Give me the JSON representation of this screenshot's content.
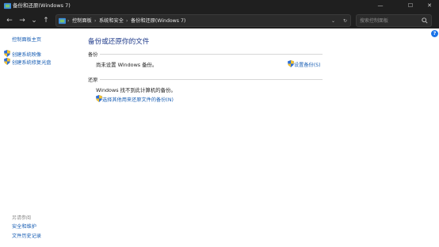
{
  "window": {
    "title": "备份和还原(Windows 7)",
    "minimize": "—",
    "maximize": "☐",
    "close": "✕"
  },
  "nav": {
    "back": "←",
    "forward": "→",
    "recent": "⌄",
    "up": "↑",
    "breadcrumbs": [
      "控制面板",
      "系统和安全",
      "备份和还原(Windows 7)"
    ],
    "separator": "›",
    "dropdown": "⌄",
    "refresh": "↻"
  },
  "search": {
    "placeholder": "搜索控制面板",
    "icon": "search-icon"
  },
  "sidebar": {
    "home": "控制面板主页",
    "tasks": [
      {
        "label": "创建系统映像",
        "icon": "shield-icon"
      },
      {
        "label": "创建系统修复光盘",
        "icon": "shield-icon"
      }
    ],
    "see_also": "另请参阅",
    "links": [
      "安全和维护",
      "文件历史记录"
    ]
  },
  "main": {
    "title": "备份或还原你的文件",
    "backup": {
      "label": "备份",
      "status": "尚未设置 Windows 备份。",
      "action": "设置备份(S)"
    },
    "restore": {
      "label": "还原",
      "status": "Windows 找不到此计算机的备份。",
      "action": "选择其他用来还原文件的备份(N)"
    }
  },
  "help": "?",
  "colors": {
    "titlebar": "#1f1f1f",
    "link": "#1a5fb4",
    "heading": "#1e3a8a",
    "shield_blue": "#2f6fd6",
    "shield_yellow": "#f2c12e"
  }
}
